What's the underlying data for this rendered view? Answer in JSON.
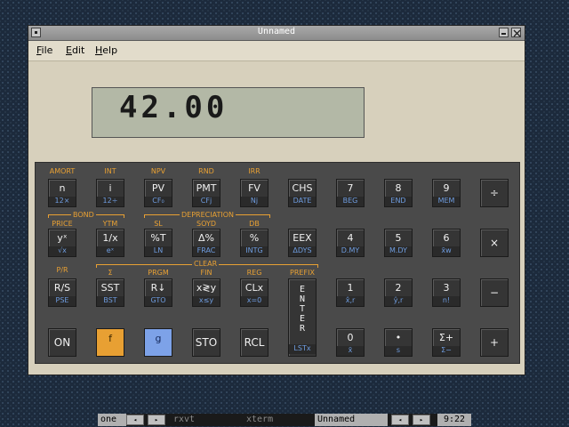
{
  "window": {
    "title": "Unnamed"
  },
  "menu": [
    {
      "mn": "F",
      "rest": "ile"
    },
    {
      "mn": "E",
      "rest": "dit"
    },
    {
      "mn": "H",
      "rest": "elp"
    }
  ],
  "display": {
    "value": "42.00"
  },
  "f_labels": {
    "amort": "AMORT",
    "int": "INT",
    "npv": "NPV",
    "rnd": "RND",
    "irr": "IRR",
    "price": "PRICE",
    "ytm": "YTM",
    "sl": "SL",
    "soyd": "SOYD",
    "db": "DB",
    "pr": "P/R",
    "sigma": "Σ",
    "prgm": "PRGM",
    "fin": "FIN",
    "reg": "REG",
    "prefix": "PREFIX"
  },
  "brackets": {
    "bond": "BOND",
    "depreciation": "DEPRECIATION",
    "clear": "CLEAR"
  },
  "keys": {
    "n": {
      "label": "n",
      "g": "12×"
    },
    "i": {
      "label": "i",
      "g": "12÷"
    },
    "pv": {
      "label": "PV",
      "g": "CF₀"
    },
    "pmt": {
      "label": "PMT",
      "g": "CFj"
    },
    "fv": {
      "label": "FV",
      "g": "Nj"
    },
    "chs": {
      "label": "CHS",
      "g": "DATE"
    },
    "k7": {
      "label": "7",
      "g": "BEG"
    },
    "k8": {
      "label": "8",
      "g": "END"
    },
    "k9": {
      "label": "9",
      "g": "MEM"
    },
    "div": {
      "label": "÷",
      "g": ""
    },
    "yx": {
      "label": "yˣ",
      "g": "√x"
    },
    "inv": {
      "label": "1/x",
      "g": "eˣ"
    },
    "pct_t": {
      "label": "%T",
      "g": "LN"
    },
    "dpct": {
      "label": "Δ%",
      "g": "FRAC"
    },
    "pct": {
      "label": "%",
      "g": "INTG"
    },
    "eex": {
      "label": "EEX",
      "g": "ΔDYS"
    },
    "k4": {
      "label": "4",
      "g": "D.MY"
    },
    "k5": {
      "label": "5",
      "g": "M.DY"
    },
    "k6": {
      "label": "6",
      "g": "x̄w"
    },
    "mul": {
      "label": "×",
      "g": ""
    },
    "rs": {
      "label": "R/S",
      "g": "PSE"
    },
    "sst": {
      "label": "SST",
      "g": "BST"
    },
    "rdown": {
      "label": "R↓",
      "g": "GTO"
    },
    "xy": {
      "label": "x≷y",
      "g": "x≤y"
    },
    "clx": {
      "label": "CLx",
      "g": "x=0"
    },
    "enter": {
      "label": "ENTER",
      "g": "LSTx"
    },
    "k1": {
      "label": "1",
      "g": "x̂,r"
    },
    "k2": {
      "label": "2",
      "g": "ŷ,r"
    },
    "k3": {
      "label": "3",
      "g": "n!"
    },
    "sub": {
      "label": "−",
      "g": ""
    },
    "on": {
      "label": "ON"
    },
    "f": {
      "label": "f"
    },
    "g": {
      "label": "g"
    },
    "sto": {
      "label": "STO"
    },
    "rcl": {
      "label": "RCL"
    },
    "k0": {
      "label": "0",
      "g": "x̄"
    },
    "dot": {
      "label": "•",
      "g": "s"
    },
    "sigma_plus": {
      "label": "Σ+",
      "g": "Σ−"
    },
    "add": {
      "label": "+",
      "g": ""
    }
  },
  "taskbar": {
    "workspace": "one",
    "tasks": [
      "rxvt",
      "xterm",
      "Unnamed"
    ],
    "clock": "9:22",
    "left_arrow": "◂",
    "right_arrow": "▸"
  },
  "colors": {
    "f_shift": "#e8a033",
    "g_shift": "#7da2e8",
    "lcd": "#b3b8a6"
  }
}
